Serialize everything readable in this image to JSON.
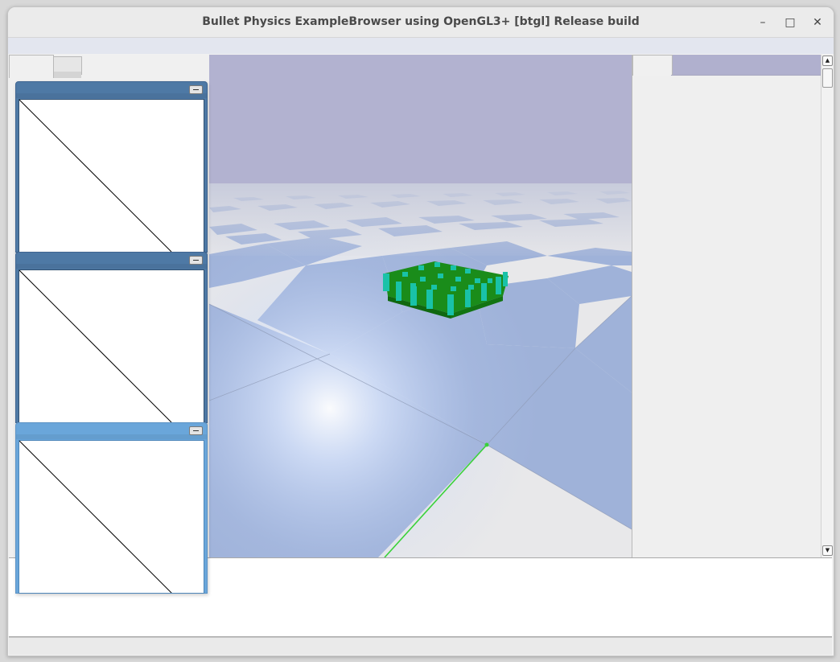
{
  "window": {
    "title": "Bullet Physics ExampleBrowser using OpenGL3+ [btgl] Release build",
    "minimize_glyph": "–",
    "maximize_glyph": "□",
    "close_glyph": "✕"
  },
  "left_tabs": [
    {
      "label": ""
    },
    {
      "label": ""
    }
  ],
  "sub_windows": [
    {
      "title": "",
      "state": "inactive"
    },
    {
      "title": "",
      "state": "inactive"
    },
    {
      "title": "",
      "state": "active"
    }
  ],
  "right_panel": {
    "tab_label": ""
  },
  "scrollbar": {
    "up_glyph": "▲",
    "down_glyph": "▼"
  },
  "console": {
    "text": ""
  },
  "status": {
    "text": ""
  },
  "colors": {
    "sky": "#b2b2d0",
    "floor_light": "#e8e8e8",
    "floor_blue": "#9fb2d9",
    "cloth_green": "#1a8c1a",
    "cloth_cyan": "#19c2a8",
    "subwindow_header": "#4e79a5",
    "subwindow_header_active": "#6aa6da"
  }
}
